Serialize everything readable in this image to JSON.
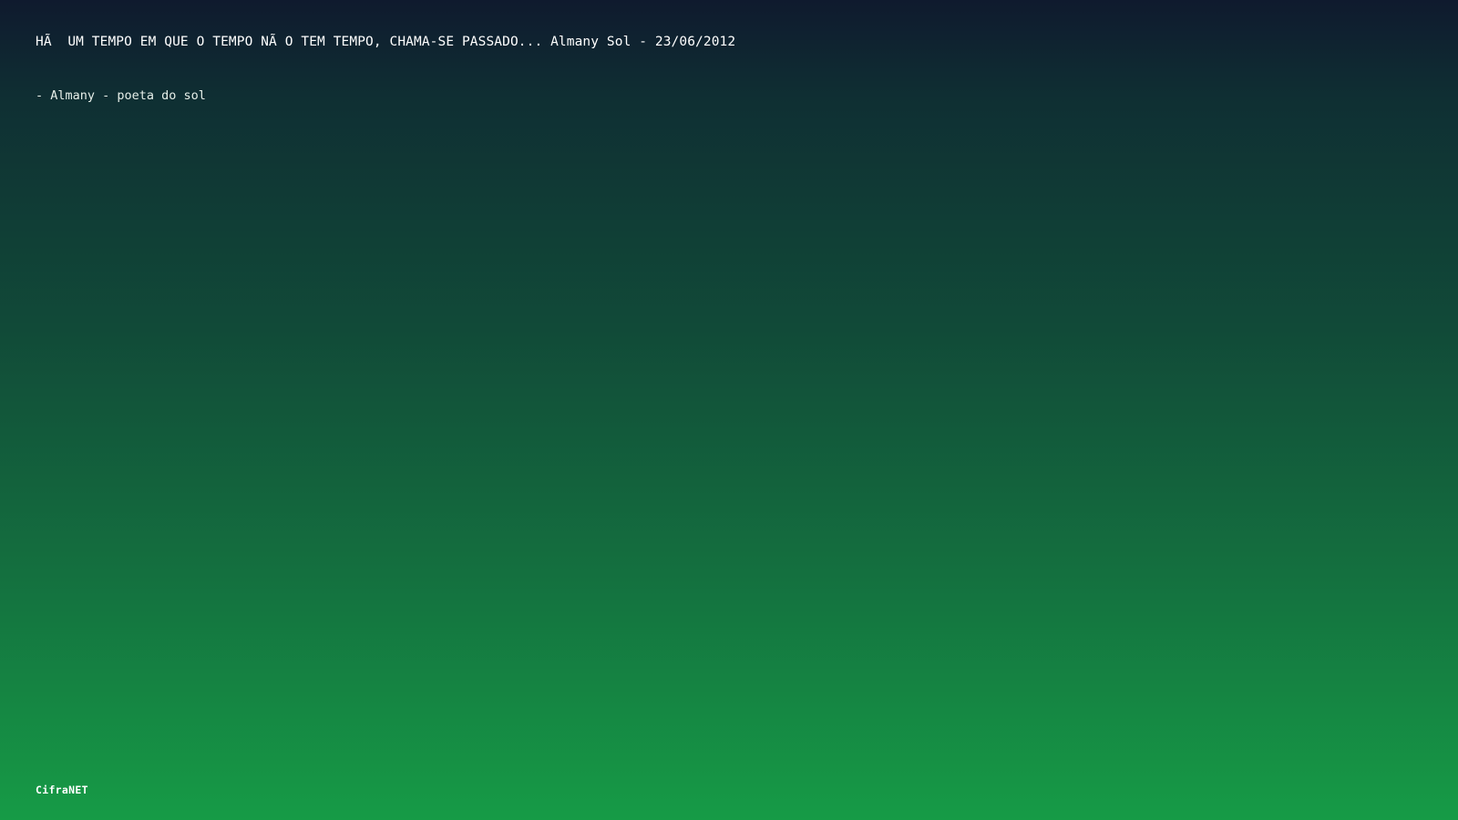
{
  "quote": {
    "text": "HÃ  UM TEMPO EM QUE O TEMPO NÃ O TEM TEMPO, CHAMA-SE PASSADO... Almany Sol - 23/06/2012"
  },
  "author": {
    "text": "- Almany - poeta do sol"
  },
  "footer": {
    "brand": "CifraNET"
  },
  "colors": {
    "background_top": "#0f1a2e",
    "background_bottom": "#169b46",
    "text": "#ffffff"
  }
}
